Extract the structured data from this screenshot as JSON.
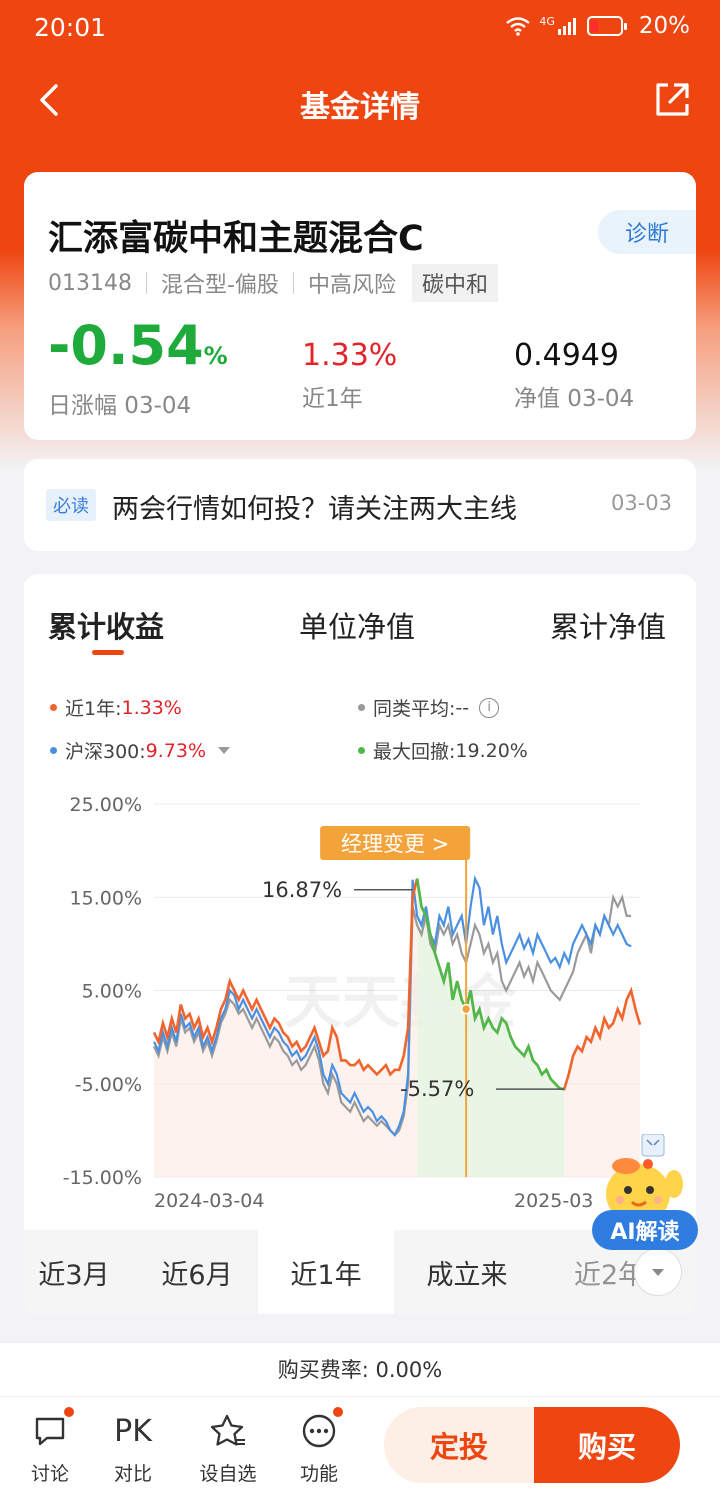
{
  "status_bar": {
    "time": "20:01",
    "signal": "4G",
    "battery": "20%"
  },
  "nav": {
    "title": "基金详情"
  },
  "fund": {
    "name": "汇添富碳中和主题混合C",
    "code": "013148",
    "type": "混合型-偏股",
    "risk": "中高风险",
    "tag": "碳中和",
    "diagnose_label": "诊断",
    "daily_change": "-0.54",
    "daily_change_unit": "%",
    "daily_change_label": "日涨幅 03-04",
    "year_return": "1.33%",
    "year_return_label": "近1年",
    "nav_value": "0.4949",
    "nav_label": "净值 03-04"
  },
  "news": {
    "badge": "必读",
    "text": "两会行情如何投？请关注两大主线",
    "date": "03-03"
  },
  "chart_tabs": [
    "累计收益",
    "单位净值",
    "累计净值"
  ],
  "legend": {
    "fund_label": "近1年:",
    "fund_value": "1.33%",
    "peer_label": "同类平均:",
    "peer_value": "--",
    "index_label": "沪深300:",
    "index_value": "9.73%",
    "drawdown_label": "最大回撤:",
    "drawdown_value": "19.20%"
  },
  "colors": {
    "fund": "#f0642e",
    "index": "#4a90e2",
    "peer": "#9a9a9a",
    "drawdown": "#4cbb4c",
    "accent": "#ee4511"
  },
  "chart_data": {
    "type": "line",
    "y_tick_labels": [
      "25.00%",
      "15.00%",
      "5.00%",
      "-5.00%",
      "-15.00%"
    ],
    "ylim": [
      -15,
      25
    ],
    "x_tick_labels": [
      "2024-03-04",
      "2025-03-04"
    ],
    "x_tick_labels_visible": [
      "2024-03-04",
      "2025-03"
    ],
    "annotations": {
      "peak": "16.87%",
      "trough": "-5.57%",
      "manager_change": "经理变更 >"
    },
    "watermark": "天天基金",
    "series": [
      {
        "name": "近1年",
        "color": "#f0642e",
        "values": [
          0.5,
          -0.5,
          1.5,
          0,
          2,
          0.5,
          3.5,
          2,
          2.5,
          1,
          2,
          0,
          1,
          -0.5,
          1,
          3,
          4,
          6,
          5,
          4,
          5,
          4,
          3,
          4,
          3,
          2,
          1,
          2,
          1.5,
          0.5,
          0,
          -1,
          -0.5,
          -1.5,
          -1,
          0,
          1,
          -0.5,
          -2,
          -1.5,
          1,
          0,
          -2.5,
          -2.5,
          -3,
          -3,
          -2.5,
          -3.5,
          -3,
          -3.5,
          -4,
          -3.5,
          -3,
          -4,
          -3.5,
          -3.5,
          -2,
          1,
          15,
          17,
          14,
          13,
          11,
          9,
          7.5,
          6,
          8,
          4,
          6,
          4,
          3,
          5,
          2,
          3,
          1,
          2,
          1,
          0.5,
          2,
          1.5,
          0,
          -1,
          -1.5,
          -2,
          -1,
          -2.5,
          -3,
          -4,
          -3.5,
          -4.5,
          -5,
          -5.5,
          -5.57,
          -4,
          -2,
          -1,
          -1.5,
          0,
          -0.5,
          1,
          0,
          2,
          1,
          1.5,
          3,
          2,
          4,
          5,
          3,
          1.33
        ]
      },
      {
        "name": "沪深300",
        "color": "#4a90e2",
        "values": [
          -0.5,
          -1.5,
          0.5,
          -1,
          1,
          -0.5,
          2.5,
          1,
          1.5,
          0,
          1,
          -1,
          0,
          -1.5,
          0,
          2,
          3,
          5,
          4.5,
          3,
          4,
          3,
          2,
          3,
          2,
          1,
          0,
          1,
          0.5,
          -0.5,
          -1,
          -2,
          -1.5,
          -2.5,
          -2,
          -1,
          0,
          -1.5,
          -4,
          -5,
          -3,
          -4,
          -6,
          -6.5,
          -7,
          -6,
          -7,
          -8,
          -7.5,
          -8,
          -9,
          -8.5,
          -9,
          -10,
          -10.5,
          -9.5,
          -8,
          -4,
          16.87,
          13,
          12,
          14,
          11,
          10,
          13,
          12,
          14,
          11,
          12,
          13,
          10,
          14,
          17,
          16,
          12,
          14,
          11,
          13,
          10,
          8,
          9,
          10,
          11,
          9.5,
          10.5,
          9,
          11,
          10,
          9,
          8,
          8.5,
          7.5,
          9,
          8,
          10,
          11,
          12,
          11,
          10,
          12,
          11,
          13,
          12,
          11,
          12,
          11,
          10,
          9.73
        ]
      },
      {
        "name": "同类平均",
        "color": "#9a9a9a",
        "values": [
          -1,
          -2,
          0,
          -1.5,
          0.5,
          -1,
          2,
          0.5,
          1,
          -0.5,
          0.5,
          -1.5,
          -0.5,
          -2,
          -0.5,
          1.5,
          2.5,
          4,
          3.5,
          2.5,
          3,
          2,
          1,
          2,
          1,
          0,
          -1,
          0,
          -0.5,
          -1.5,
          -2,
          -3,
          -2.5,
          -3.5,
          -3,
          -2,
          -1,
          -2.5,
          -5,
          -6,
          -4,
          -5,
          -7,
          -7.5,
          -8,
          -7,
          -8,
          -9,
          -8.5,
          -9,
          -9.5,
          -9,
          -9.5,
          -10,
          -10.5,
          -10,
          -8.5,
          -5,
          14,
          12,
          11,
          13,
          10,
          9,
          12,
          11,
          12,
          10,
          11,
          9,
          8,
          10,
          12,
          11,
          9,
          10,
          8,
          9,
          6,
          5,
          6,
          7,
          8,
          6.5,
          7.5,
          6,
          8,
          7,
          6,
          5,
          4.5,
          4,
          5,
          6,
          7,
          9,
          10,
          11,
          9,
          12,
          11,
          13,
          12,
          15,
          14,
          15,
          13,
          13
        ]
      }
    ]
  },
  "periods": [
    "近3月",
    "近6月",
    "近1年",
    "成立来",
    "近2年"
  ],
  "ai": {
    "label": "AI解读"
  },
  "fee": {
    "text": "购买费率: 0.00%"
  },
  "bottom_nav": {
    "discuss": "讨论",
    "compare_icon": "PK",
    "compare": "对比",
    "watchlist": "设自选",
    "functions": "功能",
    "dingtou": "定投",
    "buy": "购买"
  }
}
